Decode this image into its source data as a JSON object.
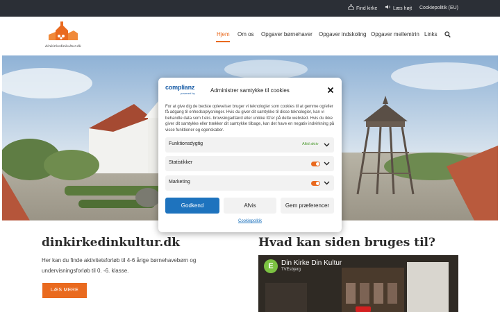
{
  "topbar": {
    "links": [
      {
        "label": "Find kirke",
        "icon": "church-icon"
      },
      {
        "label": "Læs højt",
        "icon": "speaker-icon"
      },
      {
        "label": "Cookiepolitik (EU)",
        "icon": ""
      }
    ]
  },
  "header": {
    "logo_text": "dinkirkedinkultur.dk",
    "nav": [
      {
        "label": "Hjem",
        "active": true
      },
      {
        "label": "Om os",
        "active": false
      },
      {
        "label": "Opgaver børnehaver",
        "active": false
      },
      {
        "label": "Opgaver indskoling",
        "active": false
      },
      {
        "label": "Opgaver mellemtrin",
        "active": false
      },
      {
        "label": "Links",
        "active": false
      }
    ]
  },
  "main": {
    "site_title": "dinkirkedinkultur.dk",
    "site_description": "Her kan du finde aktivitetsforløb til 4-6 årige børnehavebørn og undervisningsforløb til 0. -6. klasse.",
    "read_more_label": "LÆS MERE",
    "section_title": "Hvad kan siden bruges til?",
    "video": {
      "logo_letter": "E",
      "title": "Din Kirke Din Kultur",
      "channel": "TVEsbjerg"
    }
  },
  "consent": {
    "brand": "complianz",
    "brand_sub": "powered by",
    "title": "Administrer samtykke til cookies",
    "body": "For at give dig de bedste oplevelser bruger vi teknologier som cookies til at gemme og/eller få adgang til enhedsoplysninger. Hvis du giver dit samtykke til disse teknologier, kan vi behandle data som f.eks. browsingadfærd eller unikke ID'er på dette websted. Hvis du ikke giver dit samtykke eller trækker dit samtykke tilbage, kan det have en negativ indvirkning på visse funktioner og egenskaber.",
    "categories": [
      {
        "name": "Funktionsdygtig",
        "status": "Altid aktiv"
      },
      {
        "name": "Statistikker",
        "status": ""
      },
      {
        "name": "Marketing",
        "status": ""
      }
    ],
    "accept_label": "Godkend",
    "deny_label": "Afvis",
    "prefs_label": "Gem præferencer",
    "cookie_policy_link": "Cookiepolitik"
  },
  "colors": {
    "accent": "#e96a1f",
    "primary_button": "#1e73be",
    "topbar": "#2b2f36",
    "always_active": "#4a9a2e"
  }
}
